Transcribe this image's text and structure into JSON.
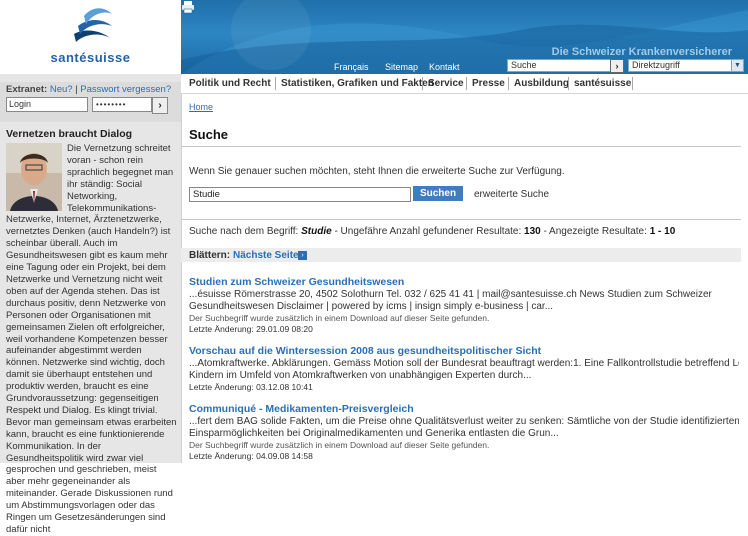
{
  "brand": "santésuisse",
  "header": {
    "claim": "Die Schweizer Krankenversicherer",
    "links": {
      "francais": "Français",
      "sitemap": "Sitemap",
      "kontakt": "Kontakt"
    },
    "search_value": "Suche",
    "direktzugriff": "Direktzugriff"
  },
  "login": {
    "label": "Extranet:",
    "neu": "Neu?",
    "pw_forgot": "Passwort vergessen?",
    "login_value": "Login",
    "password_mask": "••••••••"
  },
  "nav": [
    "Politik und Recht",
    "Statistiken, Grafiken und Fakten",
    "Service",
    "Presse",
    "Ausbildung",
    "santésuisse"
  ],
  "breadcrumb": "Home",
  "page_title": "Suche",
  "search": {
    "hint": "Wenn Sie genauer suchen möchten, steht Ihnen die erweiterte Suche zur Verfügung.",
    "query": "Studie",
    "button": "Suchen",
    "advanced": "erweiterte Suche"
  },
  "summary": {
    "prefix": "Suche nach dem Begriff:",
    "term": "Studie",
    "mid": "- Ungefähre Anzahl gefundener Resultate:",
    "count": "130",
    "mid2": "- Angezeigte Resultate:",
    "range": "1 - 10"
  },
  "paging": {
    "label": "Blättern:",
    "next": "Nächste Seite"
  },
  "results": [
    {
      "title": "Studien zum Schweizer Gesundheitswesen",
      "snippet1": "...ésuisse Römerstrasse 20, 4502 Solothurn Tel. 032 / 625 41 41 | mail@santesuisse.ch News Studien zum Schweizer",
      "snippet2": "Gesundheitswesen Disclaimer | powered by icms | insign simply e-business | car...",
      "note": "Der Suchbegriff wurde zusätzlich in einem Download auf dieser Seite gefunden.",
      "date": "Letzte Änderung: 29.01.09 08:20"
    },
    {
      "title": "Vorschau auf die Wintersession 2008 aus gesundheitspolitischer Sicht",
      "snippet1": "...Atomkraftwerke. Abklärungen. Gemäss Motion soll der Bundesrat beauftragt werden:1. Eine Fallkontrollstudie betreffend Leukämie bei",
      "snippet2": "Kindern im Umfeld von Atomkraftwerken von unabhängigen Experten durch...",
      "note": "",
      "date": "Letzte Änderung: 03.12.08 10:41"
    },
    {
      "title": "Communiqué - Medikamenten-Preisvergleich",
      "snippet1": "...fert dem BAG solide Fakten, um die Preise ohne Qualitätsverlust weiter zu senken: Sämtliche von der Studie identifizierten",
      "snippet2": "Einsparmöglichkeiten bei Originalmedikamenten und Generika entlasten die Grun...",
      "note": "Der Suchbegriff wurde zusätzlich in einem Download auf dieser Seite gefunden.",
      "date": "Letzte Änderung: 04.09.08 14:58"
    }
  ],
  "sidebar": {
    "title": "Vernetzen braucht Dialog",
    "text": "Die Vernetzung schreitet voran - schon rein sprachlich begegnet man ihr ständig: Social Networking, Telekommunikations-Netzwerke, Internet, Ärztenetzwerke, vernetztes Denken (auch Handeln?) ist scheinbar überall. Auch im Gesundheitswesen gibt es kaum mehr eine Tagung oder ein Projekt, bei dem Netzwerke und Vernetzung nicht weit oben auf der Agenda stehen. Das ist durchaus positiv, denn Netzwerke von Personen oder Organisationen mit gemeinsamen Zielen oft erfolgreicher, weil vorhandene Kompetenzen besser aufeinander abgestimmt werden können. Netzwerke sind wichtig, doch damit sie überhaupt entstehen und produktiv werden, braucht es eine Grundvoraussetzung: gegenseitigen Respekt und Dialog. Es klingt trivial. Bevor man gemeinsam etwas erarbeiten kann, braucht es eine funktionierende Kommunikation. In der Gesundheitspolitik wird zwar viel gesprochen und geschrieben, meist aber mehr gegeneinander als miteinander. Gerade Diskussionen rund um Abstimmungsvorlagen oder das Ringen um Gesetzesänderungen sind dafür nicht"
  },
  "colors": {
    "accent": "#2a6fb5",
    "banner": "#2d86c2",
    "button": "#3f7cc0"
  }
}
